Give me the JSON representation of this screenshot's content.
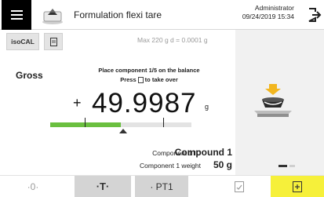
{
  "header": {
    "title": "Formulation flexi tare",
    "user": "Administrator",
    "datetime": "09/24/2019  15:34"
  },
  "toolbar": {
    "iso_label": "isoCAL"
  },
  "range_info": "Max 220 g    d = 0.0001 g",
  "main": {
    "mode_label": "Gross",
    "instruction_line1": "Place component 1/5 on the balance",
    "instruction_line2_pre": "Press",
    "instruction_line2_post": "to take over",
    "sign": "+",
    "weight": "49.9987",
    "unit": "g",
    "progress_fraction": 0.5
  },
  "components": {
    "id_label": "Component 1 ID",
    "id_value": "Compound 1",
    "weight_label": "Component 1 weight",
    "weight_value": "50 g"
  },
  "bottom_bar": {
    "zero_label": "·0·",
    "tare_label": "·T·",
    "pt_label": "· PT1"
  },
  "colors": {
    "progress": "#6abf3f",
    "take_over_button": "#f6f03a",
    "tare_button": "#d4d4d4",
    "arrow": "#f2b61f"
  },
  "icons": {
    "menu": "hamburger-icon",
    "app": "balance-app-icon",
    "logout": "logout-icon",
    "doc": "document-icon",
    "check": "checklist-icon",
    "take_over": "take-over-icon"
  }
}
